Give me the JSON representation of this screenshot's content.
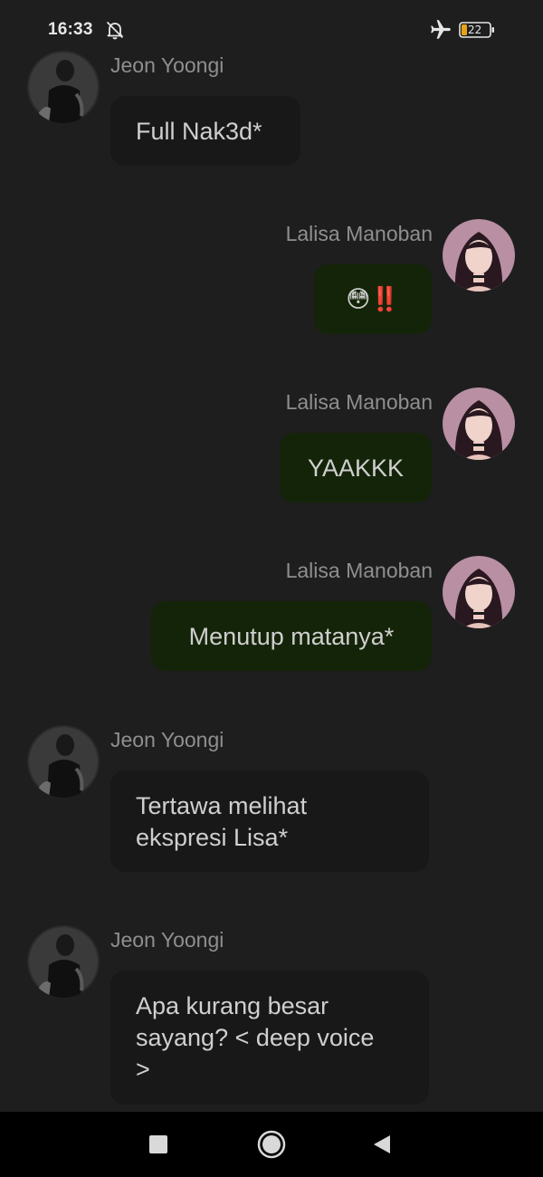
{
  "status_bar": {
    "time": "16:33",
    "battery_level": "22",
    "icons": [
      "bell-off-icon",
      "airplane-mode-icon",
      "battery-icon"
    ]
  },
  "messages": [
    {
      "sender": "Jeon Yoongi",
      "side": "left",
      "text": "Full Nak3d*"
    },
    {
      "sender": "Lalisa Manoban",
      "side": "right",
      "text": "😳‼️"
    },
    {
      "sender": "Lalisa Manoban",
      "side": "right",
      "text": "YAAKKK"
    },
    {
      "sender": "Lalisa Manoban",
      "side": "right",
      "text": "Menutup matanya*"
    },
    {
      "sender": "Jeon Yoongi",
      "side": "left",
      "text": "Tertawa melihat\nekspresi Lisa*"
    },
    {
      "sender": "Jeon Yoongi",
      "side": "left",
      "text": "Apa kurang besar\nsayang? < deep voice\n>"
    }
  ],
  "nav_bar": {
    "buttons": [
      "recents-button",
      "home-button",
      "back-button"
    ]
  },
  "colors": {
    "background": "#1e1e1e",
    "incoming_bubble": "#181818",
    "outgoing_bubble": "#142408",
    "sender_name": "#8f8f8f",
    "message_text": "#cfcfcf"
  }
}
